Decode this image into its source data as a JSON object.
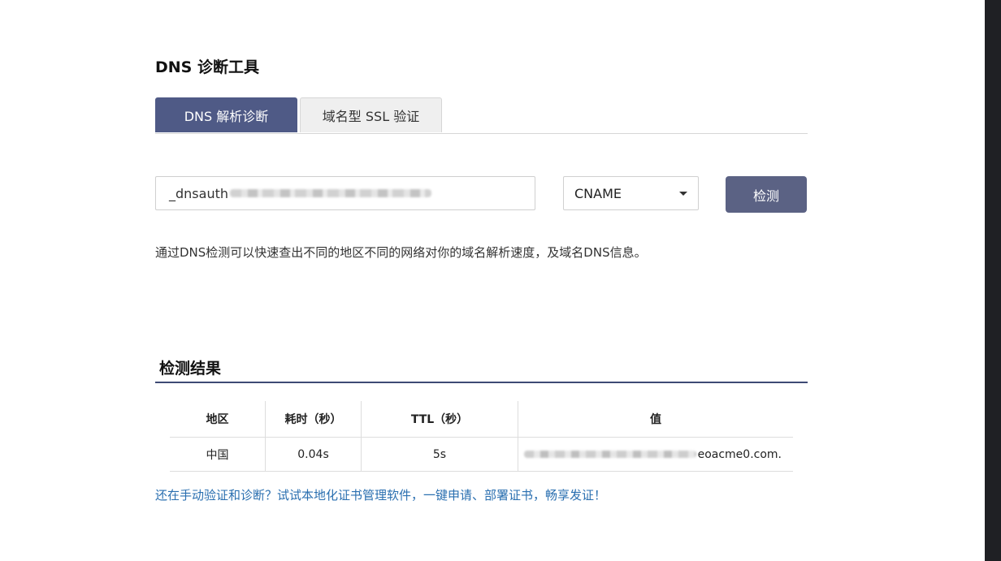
{
  "page_title": "DNS 诊断工具",
  "tabs": [
    {
      "label": "DNS 解析诊断",
      "active": true
    },
    {
      "label": "域名型 SSL 验证",
      "active": false
    }
  ],
  "domain_input": {
    "value": "_dnsauth"
  },
  "record_type": {
    "selected": "CNAME"
  },
  "check_button": {
    "label": "检测"
  },
  "description": "通过DNS检测可以快速查出不同的地区不同的网络对你的域名解析速度，及域名DNS信息。",
  "results": {
    "title": "检测结果",
    "columns": [
      "地区",
      "耗时（秒）",
      "TTL（秒）",
      "值"
    ],
    "rows": [
      {
        "region": "中国",
        "time": "0.04s",
        "ttl": "5s",
        "value_suffix": "eoacme0.com."
      }
    ]
  },
  "promo_link": "还在手动验证和诊断？试试本地化证书管理软件，一键申请、部署证书，畅享发证！",
  "colors": {
    "accent": "#4f5a86",
    "button": "#5b6284",
    "link": "#2a6fb0",
    "divider": "#3e4a74"
  }
}
